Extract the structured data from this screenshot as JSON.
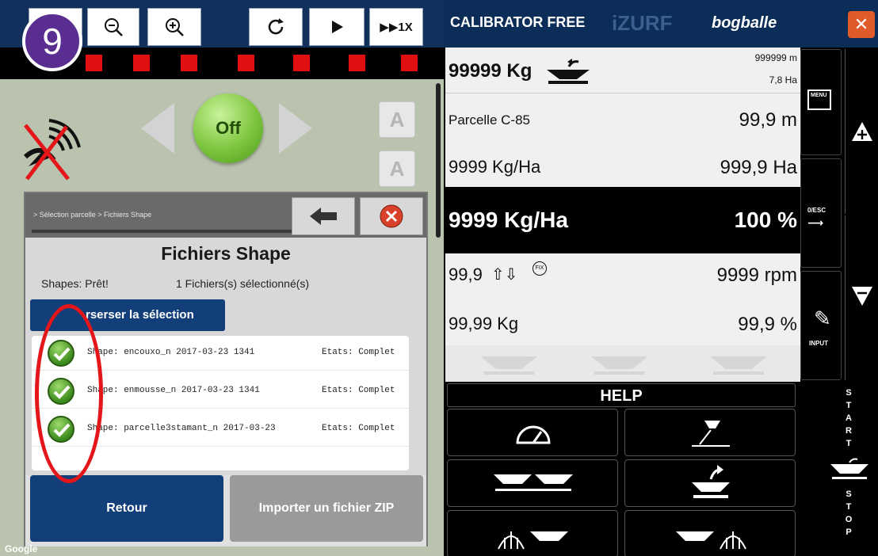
{
  "left": {
    "badge": "9",
    "toolbar": {
      "repeat_label": "▶▶1X"
    },
    "off_label": "Off",
    "side_btn_letter": "A",
    "dialog": {
      "breadcrumb": "> Sélection parcelle > Fichiers Shape",
      "title": "Fichiers Shape",
      "shapes_status": "Shapes: Prêt!",
      "selected_count": "1 Fichiers(s) sélectionné(s)",
      "invert_button": "rserser la sélection",
      "files": [
        {
          "name": "Shape: encouxo_n 2017-03-23 1341",
          "state": "Etats: Complet"
        },
        {
          "name": "Shape: enmousse_n 2017-03-23 1341",
          "state": "Etats: Complet"
        },
        {
          "name": "Shape: parcelle3stamant_n 2017-03-23",
          "state": "Etats: Complet"
        }
      ],
      "back_button": "Retour",
      "import_button": "Importer un fichier ZIP"
    },
    "google_mark": "Google"
  },
  "right": {
    "app_name": "CALIBRATOR FREE",
    "watermark": "iZURF",
    "brand": "bogballe",
    "row1": {
      "weight": "99999 Kg",
      "distance": "999999 m",
      "area": "7,8 Ha"
    },
    "row2": {
      "field": "Parcelle C-85",
      "value": "99,9 m"
    },
    "row3": {
      "rate": "9999 Kg/Ha",
      "area": "999,9 Ha"
    },
    "row4": {
      "rate": "9999 Kg/Ha",
      "percent": "100 %"
    },
    "row5": {
      "value": "99,9",
      "rpm": "9999 rpm"
    },
    "row6": {
      "weight": "99,99 Kg",
      "percent": "99,9 %"
    },
    "menu_label": "MENU",
    "esc_label": "0/ESC",
    "input_label": "INPUT",
    "help_label": "HELP",
    "start_letters": [
      "S",
      "T",
      "A",
      "R",
      "T"
    ],
    "stop_letters": [
      "S",
      "T",
      "O",
      "P"
    ]
  }
}
